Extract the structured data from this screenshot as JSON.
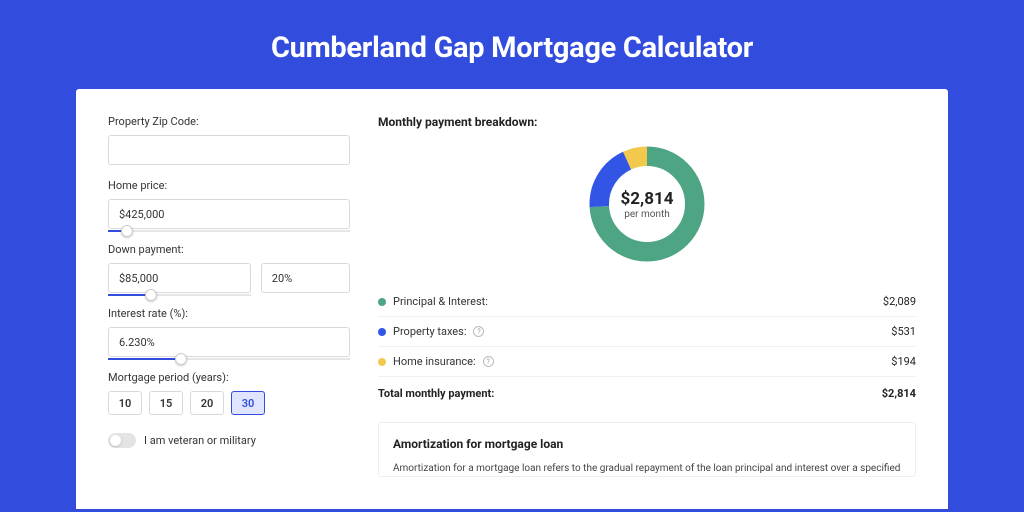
{
  "pageTitle": "Cumberland Gap Mortgage Calculator",
  "left": {
    "zipLabel": "Property Zip Code:",
    "zipValue": "",
    "homePriceLabel": "Home price:",
    "homePriceValue": "$425,000",
    "downPaymentLabel": "Down payment:",
    "downPaymentValue": "$85,000",
    "downPaymentPct": "20%",
    "interestLabel": "Interest rate (%):",
    "interestValue": "6.230%",
    "periodLabel": "Mortgage period (years):",
    "periods": [
      "10",
      "15",
      "20",
      "30"
    ],
    "activePeriodIndex": 3,
    "veteranLabel": "I am veteran or military"
  },
  "right": {
    "breakdownTitle": "Monthly payment breakdown:",
    "donutAmount": "$2,814",
    "donutSub": "per month",
    "legend": [
      {
        "label": "Principal & Interest:",
        "value": "$2,089",
        "info": false,
        "color": "green",
        "pct": 74
      },
      {
        "label": "Property taxes:",
        "value": "$531",
        "info": true,
        "color": "blue",
        "pct": 19
      },
      {
        "label": "Home insurance:",
        "value": "$194",
        "info": true,
        "color": "yellow",
        "pct": 7
      }
    ],
    "totalLabel": "Total monthly payment:",
    "totalValue": "$2,814",
    "amortTitle": "Amortization for mortgage loan",
    "amortText": "Amortization for a mortgage loan refers to the gradual repayment of the loan principal and interest over a specified"
  },
  "chart_data": {
    "type": "pie",
    "title": "Monthly payment breakdown",
    "series": [
      {
        "name": "Principal & Interest",
        "value": 2089,
        "color": "#4DA584"
      },
      {
        "name": "Property taxes",
        "value": 531,
        "color": "#3355E6"
      },
      {
        "name": "Home insurance",
        "value": 194,
        "color": "#F2C94C"
      }
    ],
    "total": 2814,
    "center_label": "$2,814 per month"
  }
}
